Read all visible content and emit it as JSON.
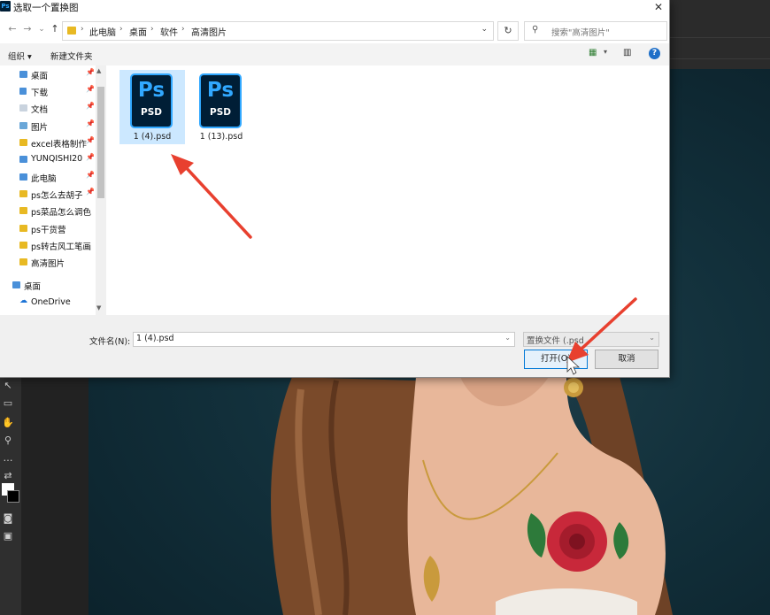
{
  "dialog": {
    "app_badge": "Ps",
    "title": "选取一个置换图",
    "close": "✕"
  },
  "nav": {
    "back": "←",
    "forward": "→",
    "recent": "⌄",
    "up": "↑",
    "breadcrumb": [
      "此电脑",
      "桌面",
      "软件",
      "高清图片"
    ],
    "search_placeholder": "搜索\"高清图片\""
  },
  "cmdbar": {
    "organize": "组织 ▾",
    "new_folder": "新建文件夹",
    "help": "?"
  },
  "sidebar": {
    "quick_access": [
      {
        "label": "桌面",
        "icon": "desktop-icon",
        "pinned": true
      },
      {
        "label": "下载",
        "icon": "download-icon",
        "pinned": true
      },
      {
        "label": "文档",
        "icon": "document-icon",
        "pinned": true
      },
      {
        "label": "图片",
        "icon": "picture-icon",
        "pinned": true
      },
      {
        "label": "excel表格制作",
        "icon": "folder-icon",
        "pinned": true
      },
      {
        "label": "YUNQISHI20",
        "icon": "pc-icon",
        "pinned": true
      },
      {
        "label": "此电脑",
        "icon": "pc-icon",
        "pinned": true
      },
      {
        "label": "ps怎么去胡子",
        "icon": "folder-icon",
        "pinned": true
      },
      {
        "label": "ps菜品怎么调色",
        "icon": "folder-icon",
        "pinned": false
      },
      {
        "label": "ps干货营",
        "icon": "folder-icon",
        "pinned": false
      },
      {
        "label": "ps转古风工笔画",
        "icon": "folder-icon",
        "pinned": false
      },
      {
        "label": "高清图片",
        "icon": "folder-icon",
        "pinned": false
      }
    ],
    "desktop": "桌面",
    "onedrive": "OneDrive"
  },
  "files": [
    {
      "name": "1 (4).psd",
      "badge": "Ps",
      "type_label": "PSD",
      "selected": true
    },
    {
      "name": "1 (13).psd",
      "badge": "Ps",
      "type_label": "PSD",
      "selected": false
    }
  ],
  "bottom": {
    "filename_label": "文件名(N):",
    "filename_value": "1 (4).psd",
    "filetype_value": "置换文件 (.psd",
    "open_button": "打开(O)",
    "cancel_button": "取消"
  },
  "colors": {
    "ps_blue": "#31a8ff",
    "ps_dark": "#001e36",
    "selection": "#cce8ff",
    "arrow_red": "#e8402f"
  }
}
